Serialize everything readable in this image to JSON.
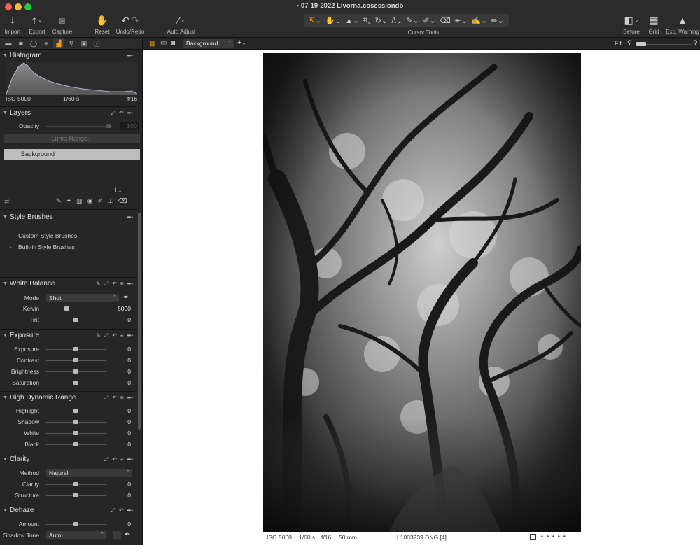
{
  "window": {
    "title": "07-19-2022 Livorna.cosessiondb"
  },
  "toolbar": {
    "import": "Import",
    "export": "Export",
    "capture": "Capture",
    "reset": "Reset",
    "undo_redo": "Undo/Redo",
    "auto_adjust": "Auto Adjust",
    "cursor_tools": "Cursor Tools",
    "before": "Before",
    "grid": "Grid",
    "exp_warning": "Exp. Warning"
  },
  "viewer_toolbar": {
    "layer_select": "Background",
    "zoom": "Fit"
  },
  "histogram": {
    "title": "Histogram",
    "iso": "ISO 5000",
    "shutter": "1/60 s",
    "aperture": "f/16"
  },
  "layers": {
    "title": "Layers",
    "opacity_label": "Opacity",
    "opacity_value": "100",
    "luma_range": "Luma Range...",
    "background_layer": "Background"
  },
  "style_brushes": {
    "title": "Style Brushes",
    "custom": "Custom Style Brushes",
    "builtin": "Built-in Style Brushes"
  },
  "white_balance": {
    "title": "White Balance",
    "mode_label": "Mode",
    "mode_value": "Shot",
    "kelvin_label": "Kelvin",
    "kelvin_value": "5000",
    "tint_label": "Tint",
    "tint_value": "0"
  },
  "exposure": {
    "title": "Exposure",
    "rows": [
      {
        "label": "Exposure",
        "value": "0"
      },
      {
        "label": "Contrast",
        "value": "0"
      },
      {
        "label": "Brightness",
        "value": "0"
      },
      {
        "label": "Saturation",
        "value": "0"
      }
    ]
  },
  "hdr": {
    "title": "High Dynamic Range",
    "rows": [
      {
        "label": "Highlight",
        "value": "0"
      },
      {
        "label": "Shadow",
        "value": "0"
      },
      {
        "label": "White",
        "value": "0"
      },
      {
        "label": "Black",
        "value": "0"
      }
    ]
  },
  "clarity": {
    "title": "Clarity",
    "method_label": "Method",
    "method_value": "Natural",
    "rows": [
      {
        "label": "Clarity",
        "value": "0"
      },
      {
        "label": "Structure",
        "value": "0"
      }
    ]
  },
  "dehaze": {
    "title": "Dehaze",
    "amount_label": "Amount",
    "amount_value": "0",
    "shadow_tone_label": "Shadow Tone",
    "shadow_tone_value": "Auto"
  },
  "photo_info": {
    "iso": "ISO 5000",
    "shutter": "1/60 s",
    "aperture": "f/16",
    "focal": "50 mm",
    "filename": "L1003239.DNG [4]"
  },
  "colors": {
    "accent": "#f39c12",
    "panel": "#262626",
    "titlebar": "#2b2b2b",
    "viewer_bg": "#ffffff",
    "layer_selected": "#bdbdbd"
  }
}
